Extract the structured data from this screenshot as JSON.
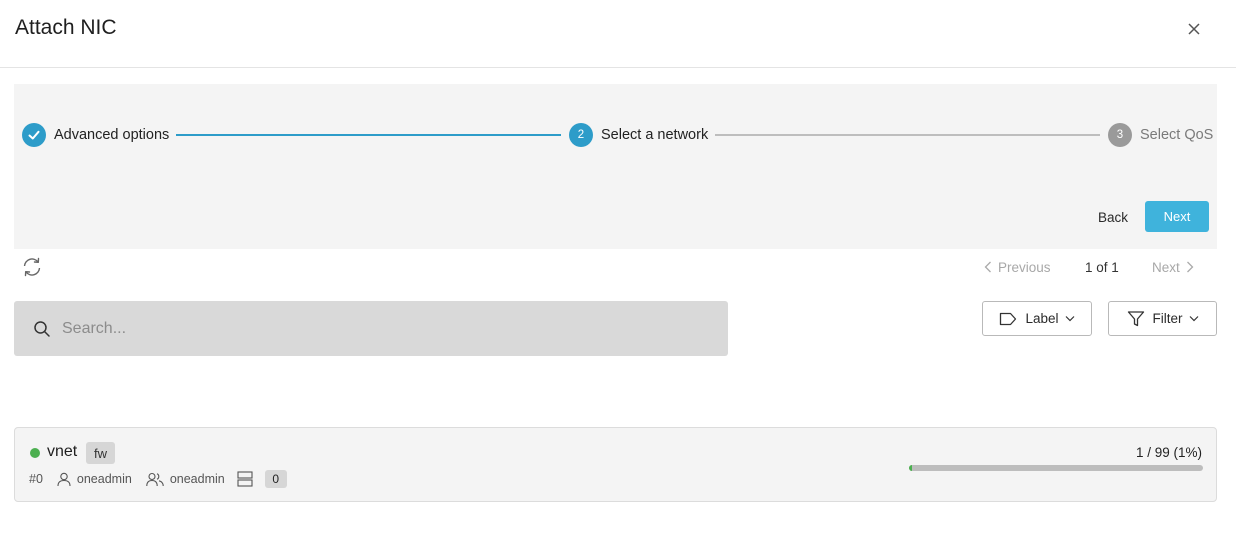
{
  "dialog": {
    "title": "Attach NIC"
  },
  "stepper": {
    "steps": [
      {
        "label": "Advanced options",
        "number": "",
        "state": "completed"
      },
      {
        "label": "Select a network",
        "number": "2",
        "state": "active"
      },
      {
        "label": "Select QoS",
        "number": "3",
        "state": "pending"
      }
    ],
    "back_label": "Back",
    "next_label": "Next"
  },
  "toolbar": {
    "pagination": {
      "previous_label": "Previous",
      "page_info": "1 of 1",
      "next_label": "Next"
    },
    "search": {
      "placeholder": "Search...",
      "value": ""
    },
    "label_button": "Label",
    "filter_button": "Filter"
  },
  "networks": [
    {
      "name": "vnet",
      "tag": "fw",
      "id": "#0",
      "owner": "oneadmin",
      "group": "oneadmin",
      "leases": "0",
      "usage_text": "1 / 99 (1%)",
      "usage_percent": 1,
      "state_color": "#4caf50"
    }
  ],
  "colors": {
    "accent": "#2d9cc9",
    "next_button": "#3fb3dc",
    "running": "#4caf50"
  },
  "icons": {
    "close": "close-icon",
    "check": "check-icon",
    "refresh": "refresh-icon",
    "search": "search-icon",
    "label": "label-tag-icon",
    "filter": "filter-icon",
    "user": "user-icon",
    "group": "group-icon",
    "leases": "server-icon"
  }
}
